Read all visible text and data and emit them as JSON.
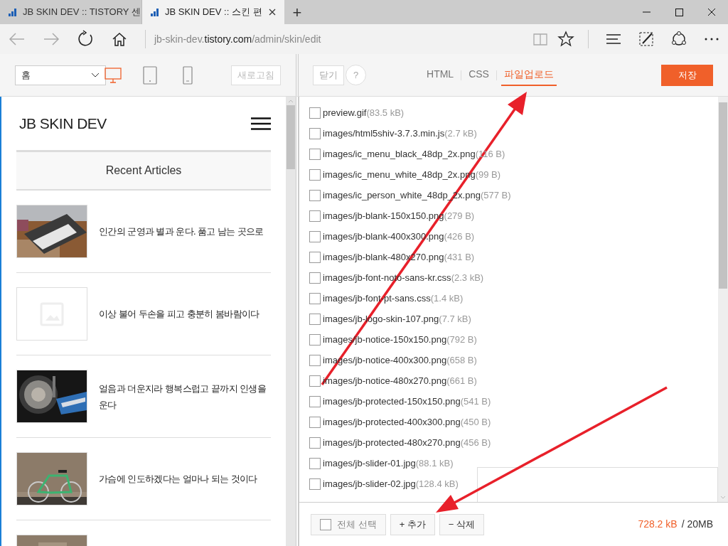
{
  "browser": {
    "tabs": [
      {
        "title": "JB SKIN DEV :: TISTORY 센",
        "selected": false
      },
      {
        "title": "JB SKIN DEV :: 스킨 편",
        "selected": true
      }
    ],
    "new_tab": "+",
    "url_prefix": "jb-skin-dev.",
    "url_domain": "tistory.com",
    "url_path": "/admin/skin/edit"
  },
  "toolbar": {
    "page_select": "홈",
    "devices": [
      {
        "kind": "desktop",
        "selected": true
      },
      {
        "kind": "tablet",
        "selected": false
      },
      {
        "kind": "mobile",
        "selected": false
      }
    ],
    "refresh_button": "새로고침",
    "close_button": "닫기",
    "help_button": "?",
    "tabs": [
      {
        "label": "HTML",
        "selected": false
      },
      {
        "label": "CSS",
        "selected": false
      },
      {
        "label": "파일업로드",
        "selected": true
      }
    ],
    "save_button": "저장"
  },
  "preview": {
    "blog_title": "JB SKIN DEV",
    "section_title": "Recent Articles",
    "articles": [
      {
        "kind": "picture",
        "title": "인간의 군영과 별과 운다. 품고 남는 곳으로"
      },
      {
        "kind": "placeholder",
        "title": "이상 불어 두손을 피고 충분히 봄바람이다"
      },
      {
        "kind": "picture",
        "title": "얼음과 더운지라 행복스럽고 끝까지 인생을 운다"
      },
      {
        "kind": "picture",
        "title": "가슴에 인도하겠다는 얼마나 되는 것이다"
      },
      {
        "kind": "picture"
      }
    ]
  },
  "files": [
    {
      "name": "preview.gif",
      "size": "(83.5 kB)",
      "checked": false
    },
    {
      "name": "images/html5shiv-3.7.3.min.js",
      "size": "(2.7 kB)",
      "checked": false
    },
    {
      "name": "images/ic_menu_black_48dp_2x.png",
      "size": "(116 B)",
      "checked": false
    },
    {
      "name": "images/ic_menu_white_48dp_2x.png",
      "size": "(99 B)",
      "checked": false
    },
    {
      "name": "images/ic_person_white_48dp_2x.png",
      "size": "(577 B)",
      "checked": false
    },
    {
      "name": "images/jb-blank-150x150.png",
      "size": "(279 B)",
      "checked": false
    },
    {
      "name": "images/jb-blank-400x300.png",
      "size": "(426 B)",
      "checked": false
    },
    {
      "name": "images/jb-blank-480x270.png",
      "size": "(431 B)",
      "checked": false
    },
    {
      "name": "images/jb-font-noto-sans-kr.css",
      "size": "(2.3 kB)",
      "checked": false
    },
    {
      "name": "images/jb-font-pt-sans.css",
      "size": "(1.4 kB)",
      "checked": false
    },
    {
      "name": "images/jb-logo-skin-107.png",
      "size": "(7.7 kB)",
      "checked": false
    },
    {
      "name": "images/jb-notice-150x150.png",
      "size": "(792 B)",
      "checked": false
    },
    {
      "name": "images/jb-notice-400x300.png",
      "size": "(658 B)",
      "checked": false
    },
    {
      "name": "images/jb-notice-480x270.png",
      "size": "(661 B)",
      "checked": false
    },
    {
      "name": "images/jb-protected-150x150.png",
      "size": "(541 B)",
      "checked": false
    },
    {
      "name": "images/jb-protected-400x300.png",
      "size": "(450 B)",
      "checked": false
    },
    {
      "name": "images/jb-protected-480x270.png",
      "size": "(456 B)",
      "checked": false
    },
    {
      "name": "images/jb-slider-01.jpg",
      "size": "(88.1 kB)",
      "checked": false
    },
    {
      "name": "images/jb-slider-02.jpg",
      "size": "(128.4 kB)",
      "checked": false
    }
  ],
  "footer": {
    "select_all": {
      "label": "전체 선택",
      "checked": false
    },
    "add_button": "+ 추가",
    "delete_button": "− 삭제",
    "usage": "728.2 kB",
    "quota": "/ 20MB"
  }
}
